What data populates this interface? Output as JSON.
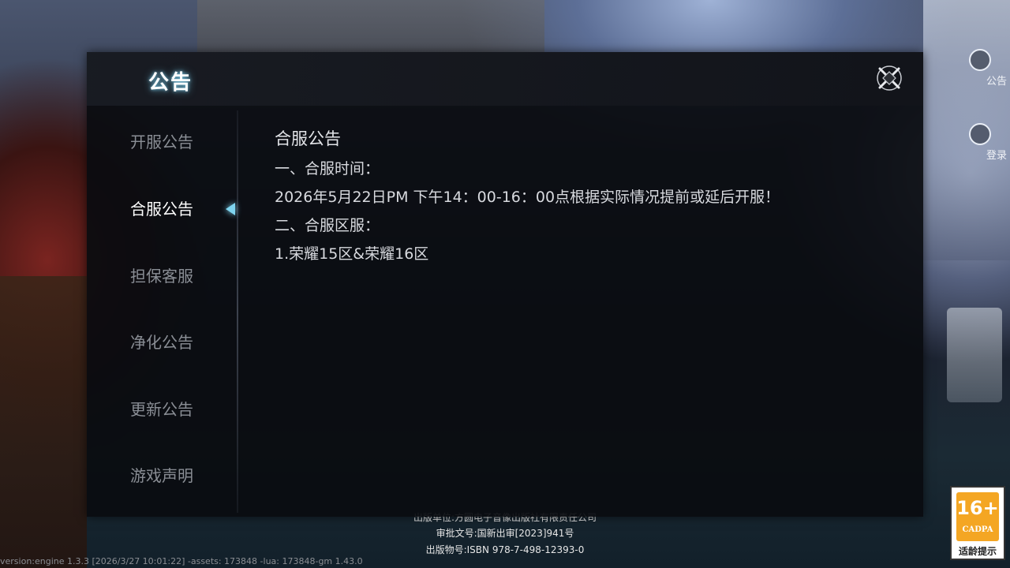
{
  "side_buttons": [
    {
      "label": "公告",
      "icon": "notice-icon"
    },
    {
      "label": "登录",
      "icon": "login-icon"
    }
  ],
  "dialog": {
    "title": "公告",
    "close_icon": "close-icon"
  },
  "tabs": [
    {
      "label": "开服公告",
      "active": false
    },
    {
      "label": "合服公告",
      "active": true
    },
    {
      "label": "担保客服",
      "active": false
    },
    {
      "label": "净化公告",
      "active": false
    },
    {
      "label": "更新公告",
      "active": false
    },
    {
      "label": "游戏声明",
      "active": false
    }
  ],
  "content": {
    "title": "合服公告",
    "lines": [
      "一、合服时间：",
      "2026年5月22日PM 下午14：00-16：00点根据实际情况提前或延后开服！",
      "二、合服区服：",
      "1.荣耀15区&荣耀16区"
    ]
  },
  "footer": {
    "publisher": "出版单位:方圆电子音像出版社有限责任公司",
    "approval": "审批文号:国新出审[2023]941号",
    "isbn": "出版物号:ISBN 978-7-498-12393-0"
  },
  "version": "version:engine 1.3.3 [2026/3/27 10:01:22] -assets: 173848 -lua: 173848-gm 1.43.0",
  "age_badge": {
    "rating": "16+",
    "org": "CADPA",
    "hint": "适龄提示"
  },
  "colors": {
    "accent": "#7fd4ef",
    "badge": "#f4a623"
  }
}
